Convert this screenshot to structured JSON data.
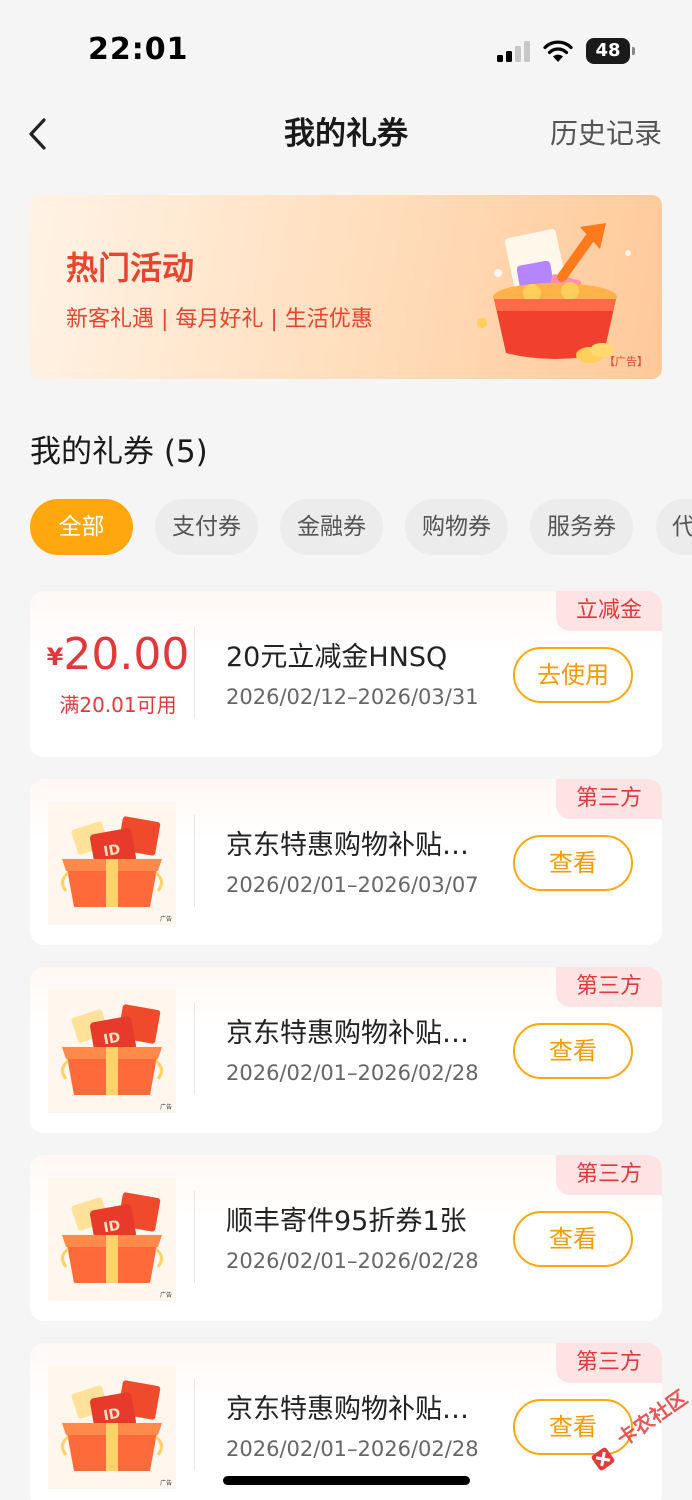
{
  "status_bar": {
    "time": "22:01",
    "battery": "48"
  },
  "nav": {
    "title": "我的礼券",
    "history": "历史记录"
  },
  "banner": {
    "title": "热门活动",
    "subtitle": "新客礼遇 | 每月好礼 | 生活优惠",
    "ad_label": "【广告】"
  },
  "section": {
    "title": "我的礼券 (5)"
  },
  "tabs": [
    {
      "label": "全部",
      "active": true
    },
    {
      "label": "支付券",
      "active": false
    },
    {
      "label": "金融券",
      "active": false
    },
    {
      "label": "购物券",
      "active": false
    },
    {
      "label": "服务券",
      "active": false
    },
    {
      "label": "代",
      "active": false
    }
  ],
  "coupons": [
    {
      "tag": "立减金",
      "currency": "¥",
      "amount": "20.00",
      "condition": "满20.01可用",
      "name": "20元立减金HNSQ",
      "date": "2026/02/12–2026/03/31",
      "button": "去使用"
    },
    {
      "tag": "第三方",
      "name": "京东特惠购物补贴…",
      "date": "2026/02/01–2026/03/07",
      "button": "查看",
      "ad_label": "广告"
    },
    {
      "tag": "第三方",
      "name": "京东特惠购物补贴…",
      "date": "2026/02/01–2026/02/28",
      "button": "查看",
      "ad_label": "广告"
    },
    {
      "tag": "第三方",
      "name": "顺丰寄件95折券1张",
      "date": "2026/02/01–2026/02/28",
      "button": "查看",
      "ad_label": "广告"
    },
    {
      "tag": "第三方",
      "name": "京东特惠购物补贴…",
      "date": "2026/02/01–2026/02/28",
      "button": "查看",
      "ad_label": "广告"
    }
  ],
  "watermark": {
    "text": "卡农社区"
  },
  "colors": {
    "accent": "#ffa70f",
    "red": "#e3383b",
    "tag_bg": "#fde3e3"
  },
  "icons": {
    "back": "chevron-left-icon",
    "signal": "cellular-signal-icon",
    "wifi": "wifi-icon",
    "battery": "battery-icon",
    "gift": "gift-box-icon"
  }
}
